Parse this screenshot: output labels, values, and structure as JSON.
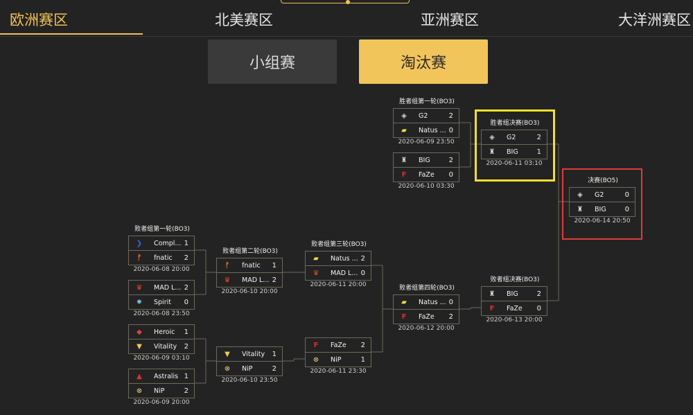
{
  "tabs": [
    "欧洲赛区",
    "北美赛区",
    "亚洲赛区",
    "大洋洲赛区"
  ],
  "stage_tabs": [
    "小组赛",
    "淘汰赛"
  ],
  "highlight_colors": {
    "upper_final": "#f3e22a",
    "grand_final": "#e23b3b",
    "accent": "#f1c453"
  },
  "matches": [
    {
      "title": "败者组第一轮(BO3)",
      "teams": [
        {
          "name": "Compl...",
          "score": "1",
          "logo": "complexity-logo"
        },
        {
          "name": "fnatic",
          "score": "2",
          "logo": "fnatic-logo"
        }
      ],
      "time": "2020-06-08 20:00"
    },
    {
      "title": "",
      "teams": [
        {
          "name": "MAD L...",
          "score": "2",
          "logo": "mad-lions-logo"
        },
        {
          "name": "Spirit",
          "score": "0",
          "logo": "spirit-logo"
        }
      ],
      "time": "2020-06-08 23:50"
    },
    {
      "title": "",
      "teams": [
        {
          "name": "Heroic",
          "score": "1",
          "logo": "heroic-logo"
        },
        {
          "name": "Vitality",
          "score": "2",
          "logo": "vitality-logo"
        }
      ],
      "time": "2020-06-09 03:10"
    },
    {
      "title": "",
      "teams": [
        {
          "name": "Astralis",
          "score": "1",
          "logo": "astralis-logo"
        },
        {
          "name": "NiP",
          "score": "2",
          "logo": "nip-logo"
        }
      ],
      "time": "2020-06-09 20:00"
    },
    {
      "title": "败者组第二轮(BO3)",
      "teams": [
        {
          "name": "fnatic",
          "score": "1",
          "logo": "fnatic-logo"
        },
        {
          "name": "MAD L...",
          "score": "2",
          "logo": "mad-lions-logo"
        }
      ],
      "time": "2020-06-10 20:00"
    },
    {
      "title": "",
      "teams": [
        {
          "name": "Vitality",
          "score": "1",
          "logo": "vitality-logo"
        },
        {
          "name": "NiP",
          "score": "2",
          "logo": "nip-logo"
        }
      ],
      "time": "2020-06-10 23:50"
    },
    {
      "title": "败者组第三轮(BO3)",
      "teams": [
        {
          "name": "Natus ...",
          "score": "2",
          "logo": "navi-logo"
        },
        {
          "name": "MAD L...",
          "score": "0",
          "logo": "mad-lions-logo"
        }
      ],
      "time": "2020-06-11 20:00"
    },
    {
      "title": "",
      "teams": [
        {
          "name": "FaZe",
          "score": "2",
          "logo": "faze-logo"
        },
        {
          "name": "NiP",
          "score": "1",
          "logo": "nip-logo"
        }
      ],
      "time": "2020-06-11 23:30"
    },
    {
      "title": "败者组第四轮(BO3)",
      "teams": [
        {
          "name": "Natus ...",
          "score": "0",
          "logo": "navi-logo"
        },
        {
          "name": "FaZe",
          "score": "2",
          "logo": "faze-logo"
        }
      ],
      "time": "2020-06-12 20:00"
    },
    {
      "title": "胜者组第一轮(BO3)",
      "teams": [
        {
          "name": "G2",
          "score": "2",
          "logo": "g2-logo"
        },
        {
          "name": "Natus ...",
          "score": "0",
          "logo": "navi-logo"
        }
      ],
      "time": "2020-06-09 23:50"
    },
    {
      "title": "",
      "teams": [
        {
          "name": "BIG",
          "score": "2",
          "logo": "big-logo"
        },
        {
          "name": "FaZe",
          "score": "0",
          "logo": "faze-logo"
        }
      ],
      "time": "2020-06-10 03:30"
    },
    {
      "title": "胜者组决赛(BO3)",
      "teams": [
        {
          "name": "G2",
          "score": "2",
          "logo": "g2-logo"
        },
        {
          "name": "BIG",
          "score": "1",
          "logo": "big-logo"
        }
      ],
      "time": "2020-06-11 03:10"
    },
    {
      "title": "败者组决赛(BO3)",
      "teams": [
        {
          "name": "BIG",
          "score": "2",
          "logo": "big-logo"
        },
        {
          "name": "FaZe",
          "score": "0",
          "logo": "faze-logo"
        }
      ],
      "time": "2020-06-13 20:00"
    },
    {
      "title": "决赛(BO5)",
      "teams": [
        {
          "name": "G2",
          "score": "0",
          "logo": "g2-logo"
        },
        {
          "name": "BIG",
          "score": "0",
          "logo": "big-logo"
        }
      ],
      "time": "2020-06-14 20:50"
    }
  ]
}
